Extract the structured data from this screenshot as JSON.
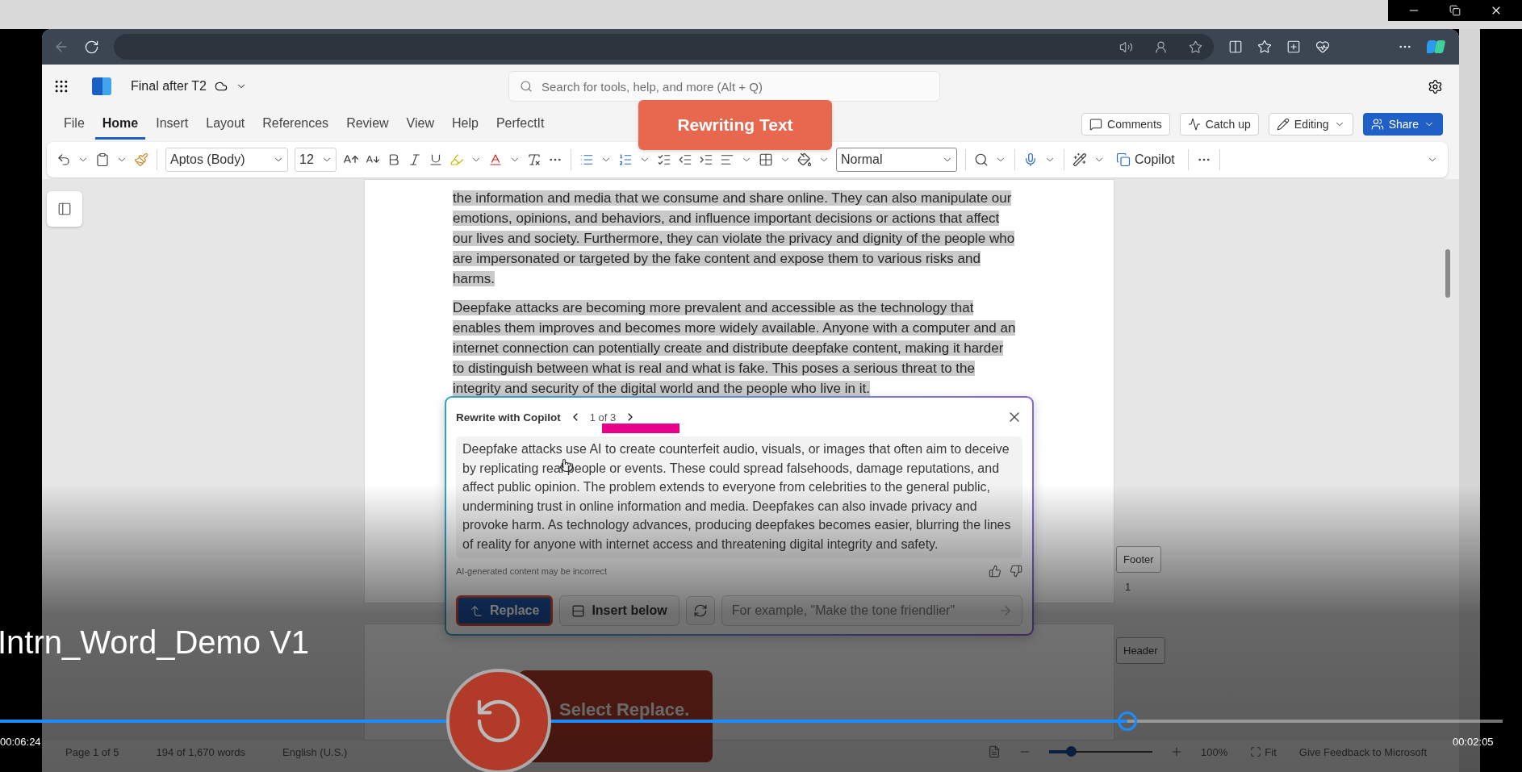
{
  "browser": {
    "back": {
      "disabled": true
    }
  },
  "app": {
    "document_title": "Final after T2",
    "search": {
      "placeholder": "Search for tools, help, and more (Alt + Q)"
    }
  },
  "ribbon_tabs": [
    {
      "label": "File",
      "selected": false
    },
    {
      "label": "Home",
      "selected": true
    },
    {
      "label": "Insert",
      "selected": false
    },
    {
      "label": "Layout",
      "selected": false
    },
    {
      "label": "References",
      "selected": false
    },
    {
      "label": "Review",
      "selected": false
    },
    {
      "label": "View",
      "selected": false
    },
    {
      "label": "Help",
      "selected": false
    },
    {
      "label": "PerfectIt",
      "selected": false
    }
  ],
  "actions": [
    {
      "label": "Comments",
      "kind": "comments"
    },
    {
      "label": "Catch up",
      "kind": "catchup"
    },
    {
      "label": "Editing",
      "kind": "editing"
    },
    {
      "label": "Share",
      "kind": "share"
    }
  ],
  "toolbar": {
    "font": "Aptos (Body)",
    "size": "12",
    "style": "Normal",
    "copilot": "Copilot"
  },
  "document": {
    "paragraphs": [
      {
        "text": "the information and media that we consume and share online. They can also manipulate our emotions, opinions, and behaviors, and influence important decisions or actions that affect our lives and society. Furthermore, they can violate the privacy and dignity of the people who are impersonated or targeted by the fake content and expose them to various risks and harms.",
        "selected": true
      },
      {
        "text": "Deepfake attacks are becoming more prevalent and accessible as the technology that enables them improves and becomes more widely available. Anyone with a computer and an internet connection can potentially create and distribute deepfake content, making it harder to distinguish between what is real and what is fake. This poses a serious threat to the integrity and security of the digital world and the people who live in it.",
        "selected": true
      }
    ],
    "footer": {
      "label": "Footer",
      "page_number": "1"
    },
    "header": {
      "label": "Header"
    }
  },
  "rewrite_panel": {
    "title": "Rewrite with Copilot",
    "counter": "1 of 3",
    "suggestion": "Deepfake attacks use AI to create counterfeit audio, visuals, or images that often aim to deceive by replicating real people or events. These could spread falsehoods, damage reputations, and affect public opinion. The problem extends to everyone from celebrities to the general public, undermining trust in online information and media. Deepfakes can also invade privacy and provoke harm. As technology advances, producing deepfakes becomes easier, blurring the lines of reality for anyone with internet access and threatening digital integrity and safety.",
    "disclaimer": "AI-generated content may be incorrect",
    "buttons": [
      {
        "label": "Replace",
        "kind": "replace"
      },
      {
        "label": "Insert below",
        "kind": "insert"
      }
    ],
    "prompt": {
      "placeholder": "For example, \"Make the tone friendlier\""
    }
  },
  "status_bar": {
    "page": "Page 1 of 5",
    "words": "194 of 1,670 words",
    "language": "English (U.S.)",
    "zoom": {
      "level": 0.21
    },
    "zoom_value": "100%",
    "fit": "Fit",
    "feedback": "Give Feedback to Microsoft"
  },
  "annotations": {
    "top": "Rewriting Text",
    "bottom": "Select Replace."
  },
  "video": {
    "title": "Intrn_Word_Demo V1",
    "elapsed": "00:06:24",
    "remaining": "00:02:05",
    "progress": {
      "level": 0.75
    }
  }
}
